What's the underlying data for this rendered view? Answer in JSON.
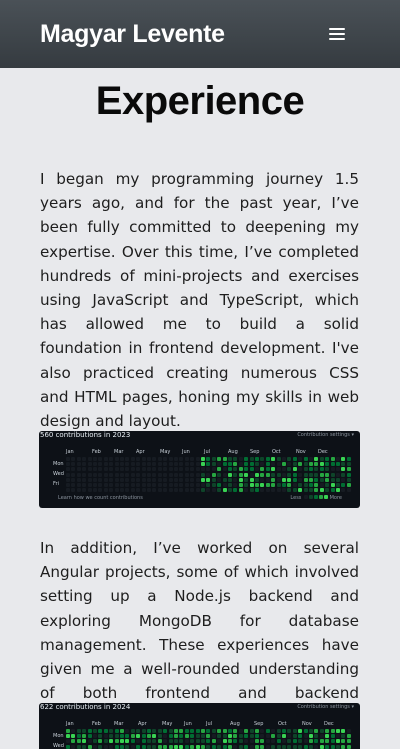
{
  "header": {
    "brand": "Magyar Levente",
    "menu_icon": "hamburger-menu-icon"
  },
  "main": {
    "title": "Experience",
    "paragraph_1": "I began my programming journey 1.5 years ago, and for the past year, I’ve been fully committed to deepening my expertise. Over this time, I’ve completed hundreds of mini-projects and exercises using JavaScript and TypeScript, which has allowed me to build a solid foundation in frontend development. I've also practiced creating numerous CSS and HTML pages, honing my skills in web design and layout.",
    "paragraph_2": "In addition, I’ve worked on several Angular projects, some of which involved setting up a Node.js backend and exploring MongoDB for database management. These experiences have given me a well-rounded understanding of both frontend and backend development."
  },
  "contributions_2023": {
    "title": "560 contributions in 2023",
    "settings": "Contribution settings ▾",
    "months": [
      "Jan",
      "Feb",
      "Mar",
      "Apr",
      "May",
      "Jun",
      "Jul",
      "Aug",
      "Sep",
      "Oct",
      "Nov",
      "Dec"
    ],
    "days": [
      "Mon",
      "Wed",
      "Fri"
    ],
    "learn": "Learn how we count contributions",
    "legend_less": "Less",
    "legend_more": "More"
  },
  "contributions_2024": {
    "title": "622 contributions in 2024",
    "settings": "Contribution settings ▾",
    "months": [
      "Jan",
      "Feb",
      "Mar",
      "Apr",
      "May",
      "Jun",
      "Jul",
      "Aug",
      "Sep",
      "Oct",
      "Nov",
      "Dec"
    ],
    "days": [
      "Mon",
      "Wed"
    ]
  },
  "colors": {
    "levels": [
      "#161b22",
      "#0e4429",
      "#006d32",
      "#26a641",
      "#39d353"
    ],
    "card_bg": "#0d1117",
    "header_bg": "#3d4449"
  }
}
